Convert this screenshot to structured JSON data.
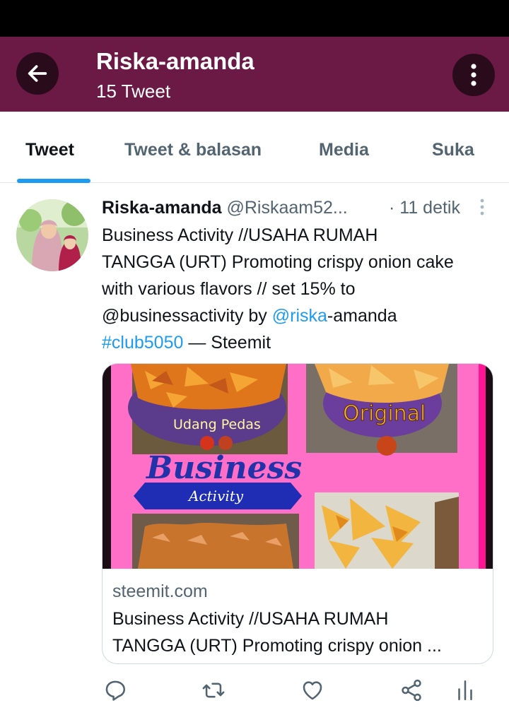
{
  "header": {
    "title": "Riska-amanda",
    "subtitle": "15 Tweet"
  },
  "tabs": [
    {
      "label": "Tweet",
      "active": true
    },
    {
      "label": "Tweet & balasan",
      "active": false
    },
    {
      "label": "Media",
      "active": false
    },
    {
      "label": "Suka",
      "active": false
    }
  ],
  "tweet": {
    "author_name": "Riska-amanda",
    "author_handle": "@Riskaam52...",
    "time": "· 11 detik",
    "text_lines": [
      "Business Activity //USAHA RUMAH",
      "TANGGA (URT) Promoting crispy onion cake",
      "with various flavors // set 15% to"
    ],
    "text_line4_a": "@businessactivity by ",
    "text_line4_link": "@riska",
    "text_line4_b": "-amanda",
    "hashtag": "#club5050",
    "text_tail": " — Steemit",
    "card": {
      "image_text": {
        "label_udang": "Udang Pedas",
        "label_original": "Original",
        "label_business": "Business",
        "label_activity": "Activity"
      },
      "domain": "steemit.com",
      "title_line1": "Business Activity //USAHA RUMAH",
      "title_line2": "TANGGA (URT) Promoting crispy onion ..."
    }
  },
  "icons": {
    "back": "arrow-left-icon",
    "more": "more-vertical-icon",
    "reply": "reply-icon",
    "retweet": "retweet-icon",
    "like": "heart-icon",
    "share": "share-icon",
    "analytics": "analytics-icon"
  },
  "colors": {
    "header_bg": "#6b1a45",
    "accent": "#1d9bf0",
    "card_bg": "#ff6fc8"
  }
}
